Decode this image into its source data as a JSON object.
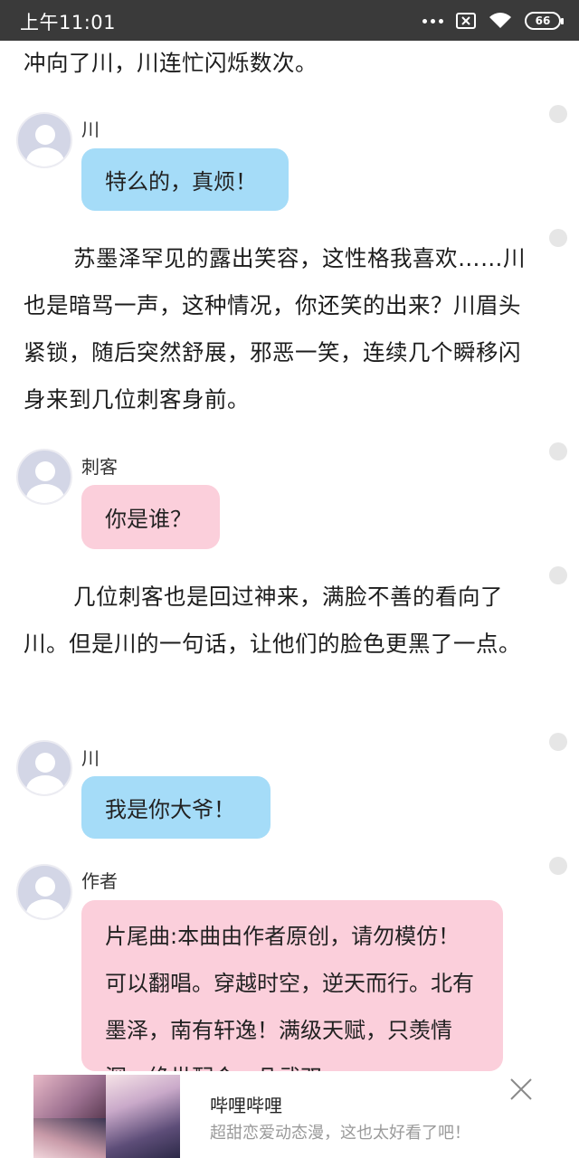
{
  "status_bar": {
    "time": "上午11:01",
    "battery": "66"
  },
  "story": {
    "n1": "冲向了川，川连忙闪烁数次。",
    "msg1": {
      "speaker": "川",
      "text": "特么的，真烦！"
    },
    "n2": "苏墨泽罕见的露出笑容，这性格我喜欢……川也是暗骂一声，这种情况，你还笑的出来？川眉头紧锁，随后突然舒展，邪恶一笑，连续几个瞬移闪身来到几位刺客身前。",
    "msg2": {
      "speaker": "刺客",
      "text": "你是谁？"
    },
    "n3": "几位刺客也是回过神来，满脸不善的看向了川。但是川的一句话，让他们的脸色更黑了一点。",
    "msg3": {
      "speaker": "川",
      "text": "我是你大爷！"
    },
    "msg4": {
      "speaker": "作者",
      "text": "片尾曲:本曲由作者原创，请勿模仿！可以翻唱。穿越时空，逆天而行。北有墨泽，南有轩逸！满级天赋，只羡情深，绝世配合，凡武双"
    }
  },
  "ad": {
    "title": "哔哩哔哩",
    "description": "超甜恋爱动态漫，这也太好看了吧！"
  },
  "icons": {
    "more": "more-dots-icon",
    "sim": "no-sim-icon",
    "wifi": "wifi-icon",
    "battery": "battery-icon",
    "avatar": "default-avatar-icon",
    "close": "close-icon"
  }
}
